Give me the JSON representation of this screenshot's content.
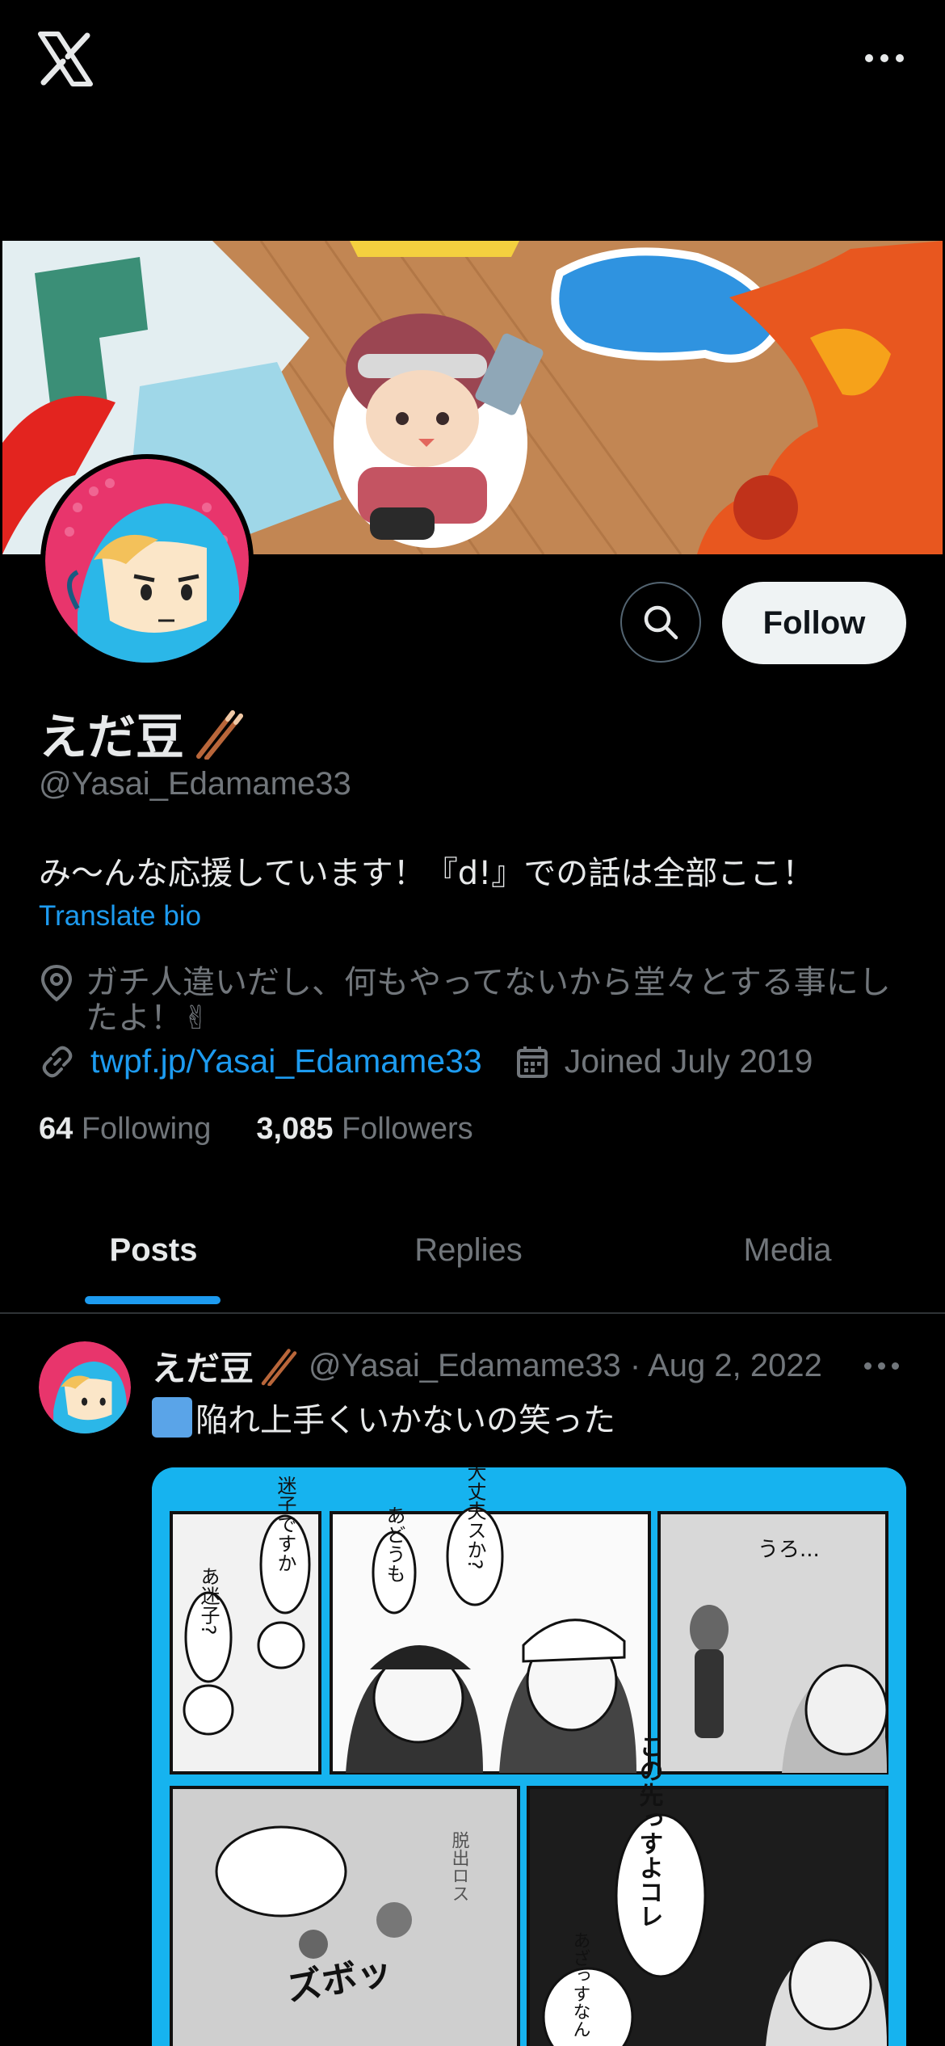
{
  "top_bar": {
    "logo_icon": "x-logo-icon",
    "menu_icon": "more-horizontal-icon"
  },
  "profile": {
    "display_name": "えだ豆",
    "name_emoji_icon": "chopsticks-icon",
    "handle": "@Yasai_Edamame33",
    "bio": "み〜んな応援しています！『d!』での話は全部ここ！",
    "translate_label": "Translate bio",
    "location": "ガチ人違いだし、何もやってないから堂々とする事にしたよ！✌",
    "website": "twpf.jp/Yasai_Edamame33",
    "joined": "Joined July 2019",
    "following_count": "64",
    "following_label": "Following",
    "followers_count": "3,085",
    "followers_label": "Followers",
    "follow_button": "Follow"
  },
  "tabs": [
    {
      "label": "Posts",
      "active": true
    },
    {
      "label": "Replies",
      "active": false
    },
    {
      "label": "Media",
      "active": false
    }
  ],
  "post": {
    "author_name": "えだ豆",
    "meta": "@Yasai_Edamame33 · Aug 2, 2022",
    "text": "陥れ上手くいかないの笑った",
    "manga_texts": {
      "bubble1": "迷子ですか",
      "bubble2": "あ迷子?",
      "bubble3": "大丈夫スか?",
      "bubble4": "あどうも",
      "bubble5": "うろ...",
      "bubble6": "この先っすよコレ",
      "bubble7": "脱出ロス",
      "bubble8": "あざっすなん",
      "sfx": "ズボッ"
    }
  },
  "colors": {
    "background": "#000000",
    "accent": "#1d9bf0",
    "secondary_text": "#71767b",
    "follow_button_bg": "#eff3f4"
  }
}
